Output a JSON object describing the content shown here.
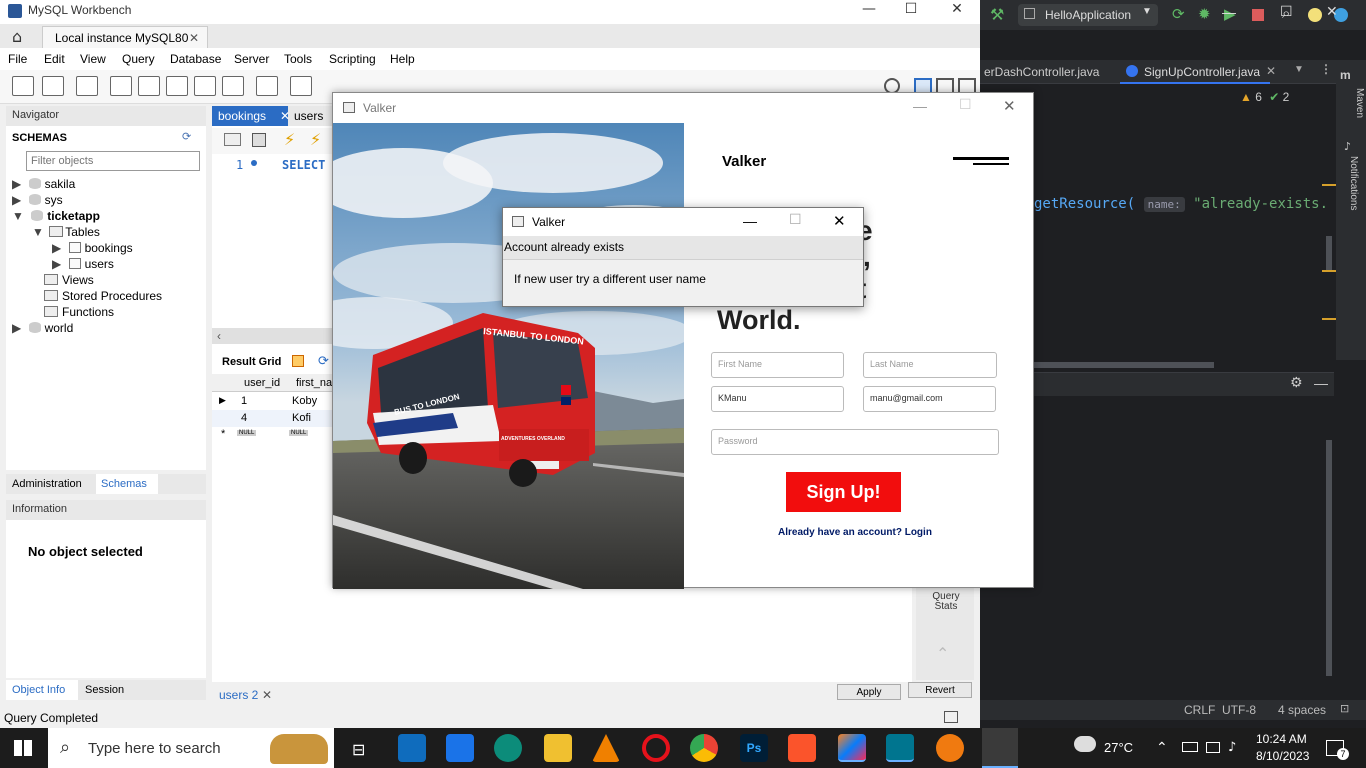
{
  "workbench": {
    "title": "MySQL Workbench",
    "connection_tab": "Local instance MySQL80",
    "menu": [
      "File",
      "Edit",
      "View",
      "Query",
      "Database",
      "Server",
      "Tools",
      "Scripting",
      "Help"
    ],
    "navigator_label": "Navigator",
    "schemas_label": "SCHEMAS",
    "filter_placeholder": "Filter objects",
    "tree": {
      "sakila": "sakila",
      "sys": "sys",
      "ticketapp": "ticketapp",
      "tables": "Tables",
      "bookings": "bookings",
      "users": "users",
      "views": "Views",
      "stored_procedures": "Stored Procedures",
      "functions": "Functions",
      "world": "world"
    },
    "nav_tabs": {
      "administration": "Administration",
      "schemas": "Schemas"
    },
    "information_label": "Information",
    "no_object": "No object selected",
    "bottom_tabs": {
      "object_info": "Object Info",
      "session": "Session"
    },
    "status": "Query Completed",
    "editor_tabs": {
      "bookings": "bookings",
      "users": "users"
    },
    "sql_line_no": "1",
    "sql_text": "SELECT",
    "result_grid_label": "Result Grid",
    "grid_headers": [
      "user_id",
      "first_na"
    ],
    "grid_rows": [
      [
        "1",
        "Koby"
      ],
      [
        "4",
        "Kofi"
      ]
    ],
    "null_label": "NULL",
    "result_tab": "users 2",
    "apply_label": "Apply",
    "revert_label": "Revert",
    "query_stats": "Query Stats"
  },
  "valker": {
    "window_title": "Valker",
    "brand": "Valker",
    "headline_partial": "World.",
    "headline_frag_1": "e",
    "headline_frag_2": ",",
    "headline_frag_3": "t",
    "first_name_placeholder": "First Name",
    "last_name_placeholder": "Last Name",
    "username_value": "KManu",
    "email_value": "manu@gmail.com",
    "password_placeholder": "Password",
    "signup_label": "Sign Up!",
    "login_link": "Already have an account? Login",
    "bus_sign_top": "ISTANBUL TO LONDON",
    "bus_sign_side": "BUS TO LONDON",
    "bus_sign_brand": "ADVENTURES OVERLAND"
  },
  "dialog": {
    "title": "Valker",
    "header": "Account already exists",
    "message": "If new user try a different user name"
  },
  "ide": {
    "run_config": "HelloApplication",
    "tab1": "erDashController.java",
    "tab2": "SignUpController.java",
    "warnings": "6",
    "checks": "2",
    "code_method": "getResource(",
    "code_hint": "name:",
    "code_string": "\"already-exists.",
    "side_maven": "Maven",
    "side_notifications": "Notifications",
    "status_crlf": "CRLF",
    "status_encoding": "UTF-8",
    "status_indent": "4 spaces"
  },
  "taskbar": {
    "search_placeholder": "Type here to search",
    "temperature": "27°C",
    "time": "10:24 AM",
    "date": "8/10/2023",
    "notification_count": "7"
  },
  "colors": {
    "accent_blue": "#0078d7",
    "signup_red": "#f20d0d",
    "ide_bg": "#1e1f22",
    "taskbar_bg": "#1c1c1c"
  }
}
